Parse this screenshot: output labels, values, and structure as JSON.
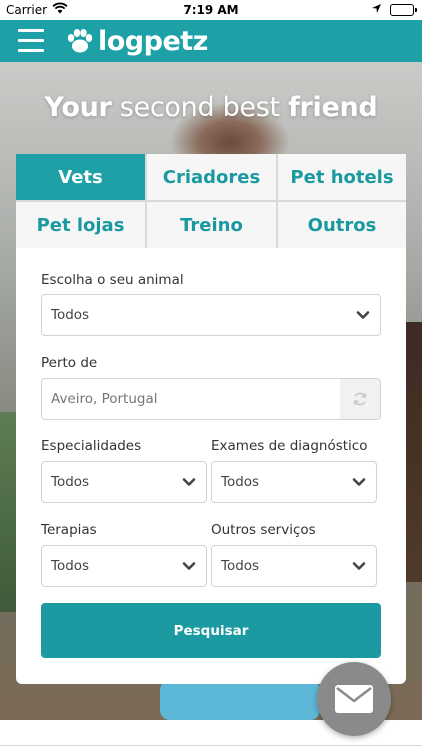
{
  "status_bar": {
    "carrier": "Carrier",
    "time": "7:19 AM"
  },
  "navbar": {
    "logo_text": "logpetz"
  },
  "hero": {
    "tagline_bold1": "Your",
    "tagline_light": " second best ",
    "tagline_bold2": "friend"
  },
  "tabs": [
    {
      "label": "Vets",
      "active": true
    },
    {
      "label": "Criadores",
      "active": false
    },
    {
      "label": "Pet hotels",
      "active": false
    },
    {
      "label": "Pet lojas",
      "active": false
    },
    {
      "label": "Treino",
      "active": false
    },
    {
      "label": "Outros",
      "active": false
    }
  ],
  "form": {
    "animal": {
      "label": "Escolha o seu animal",
      "value": "Todos"
    },
    "location": {
      "label": "Perto de",
      "placeholder": "Aveiro, Portugal"
    },
    "specialties": {
      "label": "Especialidades",
      "value": "Todos"
    },
    "diagnostics": {
      "label": "Exames de diagnóstico",
      "value": "Todos"
    },
    "therapies": {
      "label": "Terapias",
      "value": "Todos"
    },
    "other_services": {
      "label": "Outros serviços",
      "value": "Todos"
    },
    "search_label": "Pesquisar"
  },
  "colors": {
    "brand": "#1da1a6",
    "tab_text": "#1a9aa0"
  },
  "icons": [
    "menu-icon",
    "paw-icon",
    "wifi-icon",
    "location-arrow-icon",
    "battery-icon",
    "chevron-down-icon",
    "refresh-icon",
    "mail-icon"
  ]
}
